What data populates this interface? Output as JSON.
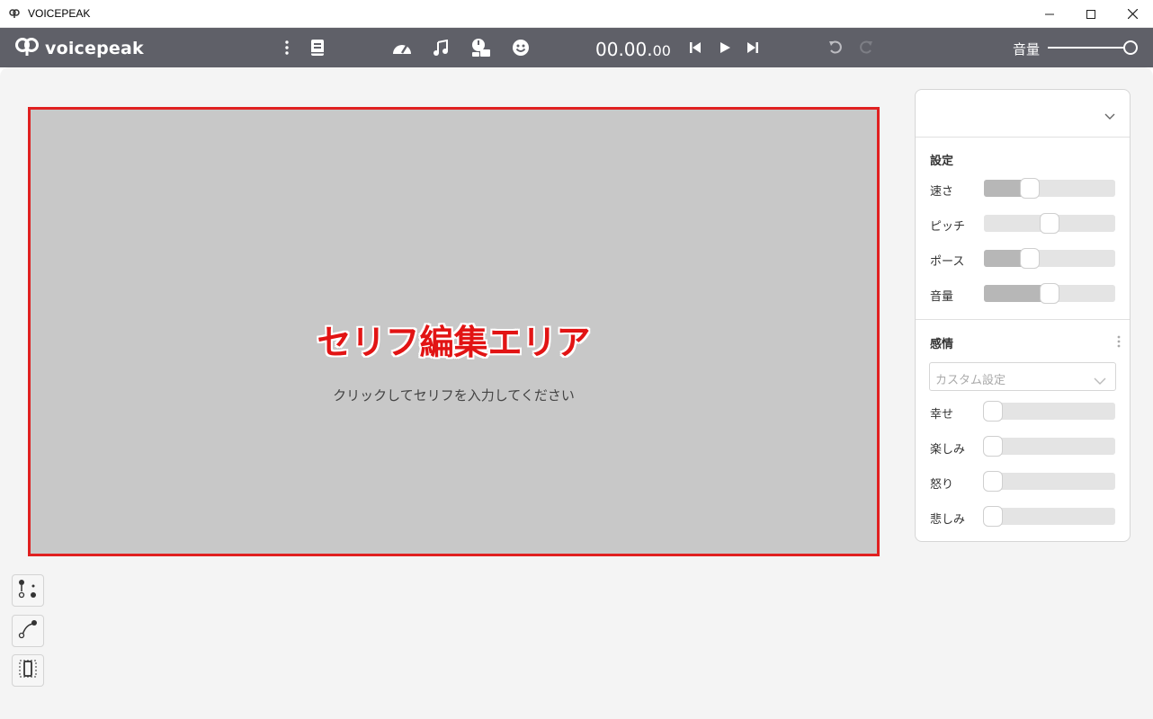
{
  "window": {
    "title": "VOICEPEAK"
  },
  "toolbar": {
    "brand": "voicepeak",
    "time_main": "00.00.",
    "time_ms": "00",
    "volume_label": "音量",
    "volume_level": 1.0,
    "icons": [
      "kebab-menu-icon",
      "dictionary-icon",
      "speedometer-icon",
      "music-note-icon",
      "timer-icon",
      "emotion-icon",
      "skip-back-icon",
      "play-icon",
      "skip-forward-icon",
      "undo-icon",
      "redo-icon"
    ]
  },
  "edit_area": {
    "title": "セリフ編集エリア",
    "hint": "クリックしてセリフを入力してください"
  },
  "panel": {
    "narrator_selected": "",
    "settings_title": "設定",
    "settings": [
      {
        "label": "速さ",
        "level": 0.35
      },
      {
        "label": "ピッチ",
        "level": 0.5
      },
      {
        "label": "ポース",
        "level": 0.35
      },
      {
        "label": "音量",
        "level": 0.5
      }
    ],
    "emotion_title": "感情",
    "preset_placeholder": "カスタム設定",
    "emotions": [
      {
        "label": "幸せ",
        "level": 0
      },
      {
        "label": "楽しみ",
        "level": 0
      },
      {
        "label": "怒り",
        "level": 0
      },
      {
        "label": "悲しみ",
        "level": 0
      }
    ]
  },
  "tools": [
    "phoneme-tool-icon",
    "curve-tool-icon",
    "selection-tool-icon"
  ],
  "colors": {
    "toolbar": "#5f6068",
    "accent_red": "#e21414",
    "edit_bg": "#c8c8c8"
  }
}
